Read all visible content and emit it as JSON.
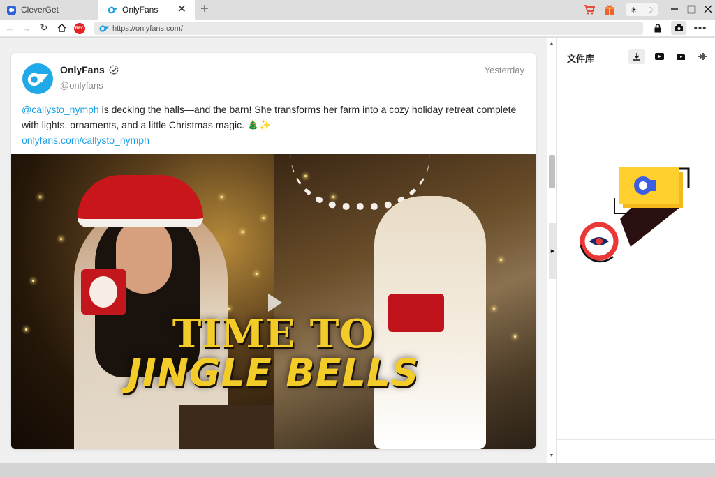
{
  "tabs": [
    {
      "label": "CleverGet",
      "active": false
    },
    {
      "label": "OnlyFans",
      "active": true
    }
  ],
  "icons": {
    "new_tab": "plus-icon",
    "cart": "cart-icon",
    "gift": "gift-icon",
    "theme_light": "sun-icon",
    "theme_dark": "moon-icon"
  },
  "nav": {
    "url": "https://onlyfans.com/",
    "rec_label": "REC"
  },
  "post": {
    "author_name": "OnlyFans",
    "author_handle": "@onlyfans",
    "time": "Yesterday",
    "mention": "@callysto_nymph",
    "text_rest": " is decking the halls—and the barn! She transforms her farm into a cozy holiday retreat complete with lights, ornaments, and a little Christmas magic. 🎄✨",
    "link": "onlyfans.com/callysto_nymph",
    "video_title_line1": "TIME TO",
    "video_title_line2": "JINGLE BELLS"
  },
  "library": {
    "title": "文件库"
  },
  "colors": {
    "accent_blue": "#1fa0e4",
    "rec_red": "#e52222",
    "title_yellow": "#f3cc2a"
  }
}
